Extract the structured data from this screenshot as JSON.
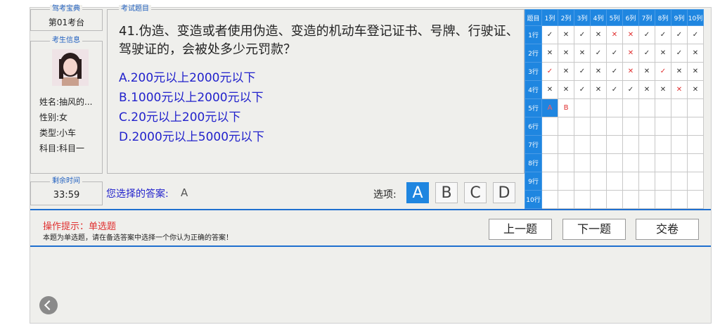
{
  "app": {
    "title": "驾考宝典",
    "seat": "第01考台"
  },
  "candidate": {
    "section_label": "考生信息",
    "name": "姓名:抽风的...",
    "gender": "性别:女",
    "type": "类型:小车",
    "subject": "科目:科目一"
  },
  "timer": {
    "label": "剩余时间",
    "value": "33:59"
  },
  "question": {
    "section_label": "考试题目",
    "text": "41.伪造、变造或者使用伪造、变造的机动车登记证书、号牌、行驶证、驾驶证的，会被处多少元罚款？",
    "options": [
      "A.200元以上2000元以下",
      "B.1000元以上2000元以下",
      "C.20元以上200元以下",
      "D.2000元以上5000元以下"
    ]
  },
  "answer": {
    "label": "您选择的答案:",
    "value": "A",
    "choices_label": "选项:",
    "choices": [
      "A",
      "B",
      "C",
      "D"
    ],
    "selected": "A"
  },
  "grid": {
    "corner": "题目",
    "cols": [
      "1列",
      "2列",
      "3列",
      "4列",
      "5列",
      "6列",
      "7列",
      "8列",
      "9列",
      "10列"
    ],
    "rows": [
      "1行",
      "2行",
      "3行",
      "4行",
      "5行",
      "6行",
      "7行",
      "8行",
      "9行",
      "10行"
    ],
    "marks": [
      [
        "✓",
        "✕",
        "✓",
        "✕",
        "✕",
        "✕",
        "✓",
        "✓",
        "✓",
        "✓"
      ],
      [
        "✕",
        "✕",
        "✕",
        "✓",
        "✓",
        "✕",
        "✓",
        "✕",
        "✓",
        "✕"
      ],
      [
        "✓",
        "✕",
        "✓",
        "✕",
        "✓",
        "✕",
        "✕",
        "✓",
        "✕",
        "✕"
      ],
      [
        "✕",
        "✕",
        "✓",
        "✕",
        "✓",
        "✓",
        "✕",
        "✕",
        "✕",
        "✕"
      ],
      [
        "A",
        "B",
        "",
        "",
        "",
        "",
        "",
        "",
        "",
        ""
      ],
      [
        "",
        "",
        "",
        "",
        "",
        "",
        "",
        "",
        "",
        ""
      ],
      [
        "",
        "",
        "",
        "",
        "",
        "",
        "",
        "",
        "",
        ""
      ],
      [
        "",
        "",
        "",
        "",
        "",
        "",
        "",
        "",
        "",
        ""
      ],
      [
        "",
        "",
        "",
        "",
        "",
        "",
        "",
        "",
        "",
        ""
      ],
      [
        "",
        "",
        "",
        "",
        "",
        "",
        "",
        "",
        "",
        ""
      ]
    ],
    "wrong_cells": [
      "1-5",
      "1-6",
      "2-6",
      "3-1",
      "3-6",
      "3-8",
      "4-9"
    ],
    "current_cell": "5-1"
  },
  "hint": {
    "title": "操作提示：单选题",
    "text": "本题为单选题，请在备选答案中选择一个你认为正确的答案！"
  },
  "buttons": {
    "prev": "上一题",
    "next": "下一题",
    "submit": "交卷"
  },
  "colors": {
    "accent": "#1f86e0",
    "wrong": "#e03030"
  }
}
